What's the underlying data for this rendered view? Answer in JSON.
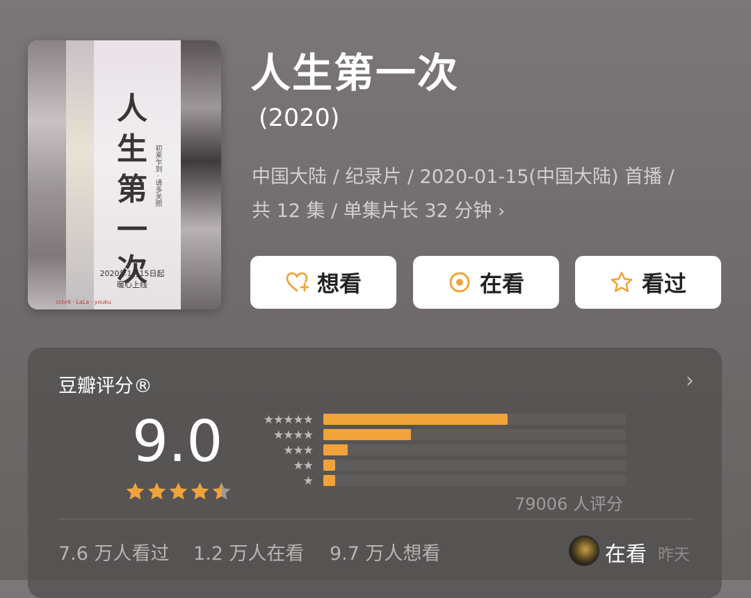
{
  "poster": {
    "title": "人生第一次",
    "subtitle": "初来乍到 · 请多关照",
    "release_line1": "2020年1月15日起",
    "release_line2": "暖心上线",
    "logos": "cctv9 · LaLa · youku"
  },
  "movie": {
    "title": "人生第一次",
    "year": "(2020)",
    "meta_line1": "中国大陆 / 纪录片 / 2020-01-15(中国大陆) 首播 /",
    "meta_line2": "共 12 集 / 单集片长 32 分钟",
    "meta_chevron": "›"
  },
  "actions": {
    "want": "想看",
    "watching": "在看",
    "watched": "看过"
  },
  "rating": {
    "heading": "豆瓣评分®",
    "chevron": "›",
    "score": "9.0",
    "stars_value": 4.5,
    "star_rows": [
      "★★★★★",
      "★★★★",
      "★★★",
      "★★",
      "★"
    ],
    "distribution": [
      0.61,
      0.29,
      0.08,
      0.04,
      0.04
    ],
    "count": "79006 人评分"
  },
  "stats": {
    "watched": "7.6 万人看过",
    "watching": "1.2 万人在看",
    "want": "9.7 万人想看"
  },
  "user_status": {
    "label": "在看",
    "time": "昨天"
  },
  "colors": {
    "accent": "#f0a33a",
    "background": "#746f70",
    "card": "#4f4d4d"
  }
}
